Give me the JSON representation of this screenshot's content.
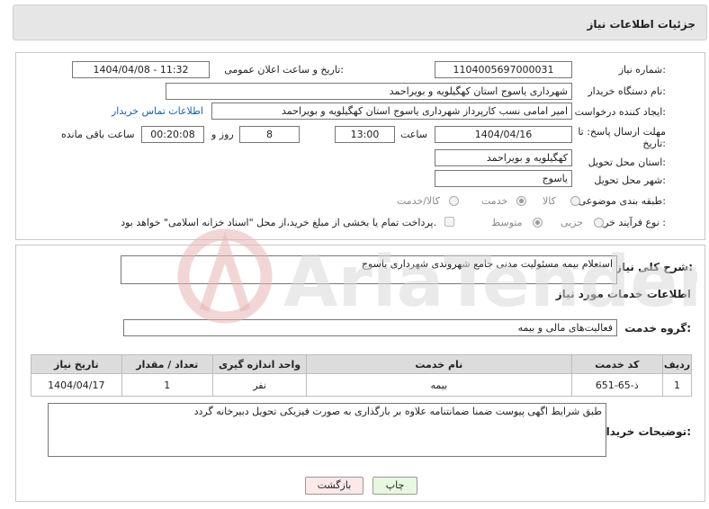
{
  "header": {
    "title": "جزئیات اطلاعات نیاز"
  },
  "fields": {
    "need_number_label": "شماره نیاز:",
    "need_number": "1104005697000031",
    "announce_label": "تاریخ و ساعت اعلان عمومی:",
    "announce_value": "1404/04/08 - 11:32",
    "buyer_org_label": "نام دستگاه خریدار:",
    "buyer_org": "شهرداری یاسوج استان کهگیلویه و بویراحمد",
    "creator_label": "ایجاد کننده درخواست:",
    "creator": "امیر امامی نسب کارپرداز شهرداری یاسوج استان کهگیلویه و بویراحمد",
    "contact_link": "اطلاعات تماس خریدار",
    "deadline_label_1": "مهلت ارسال پاسخ: تا",
    "deadline_label_2": "تاریخ:",
    "deadline_date": "1404/04/16",
    "time_label": "ساعت",
    "deadline_time": "13:00",
    "days_value": "8",
    "days_label": "روز و",
    "remaining_time": "00:20:08",
    "remaining_label": "ساعت باقی مانده",
    "province_label": "استان محل تحویل:",
    "province": "کهگیلویه و بویراحمد",
    "city_label": "شهر محل تحویل:",
    "city": "یاسوج",
    "category_label": "طبقه بندی موضوعی:",
    "category_options": [
      "کالا",
      "خدمت",
      "کالا/خدمت"
    ],
    "category_selected": "خدمت",
    "process_label": "نوع فرآیند خرید :",
    "process_options": [
      "جزیی",
      "متوسط"
    ],
    "process_selected": "متوسط",
    "payment_note": "پرداخت تمام یا بخشی از مبلغ خرید،از محل \"اسناد خزانه اسلامی\" خواهد بود."
  },
  "summary": {
    "label": "شرح کلی نیاز:",
    "value": "استعلام بیمه مسئولیت مدنی جامع شهروندی شهرداری یاسوج"
  },
  "services": {
    "section_title": "اطلاعات خدمات مورد نیاز",
    "group_label": "گروه خدمت:",
    "group_value": "فعالیت‌های مالی و بیمه",
    "table": {
      "headers": [
        "ردیف",
        "کد خدمت",
        "نام خدمت",
        "واحد اندازه گیری",
        "تعداد / مقدار",
        "تاریخ نیاز"
      ],
      "rows": [
        [
          "1",
          "ذ-65-651",
          "بیمه",
          "نفر",
          "1",
          "1404/04/17"
        ]
      ]
    }
  },
  "notes": {
    "label": "توضیحات خریدار:",
    "value": "طبق شرایط اگهی پیوست ضمنا ضمانتنامه علاوه بر بارگذاری به صورت فیزیکی تحویل دبیرخانه گردد"
  },
  "buttons": {
    "print": "چاپ",
    "back": "بازگشت"
  },
  "watermark": {
    "text": "AriaTender.net"
  },
  "colors": {
    "link": "#1a5fb4",
    "print_bg": "#e8f7e0",
    "back_bg": "#fde8e8",
    "table_header": "#dcdcdc"
  }
}
